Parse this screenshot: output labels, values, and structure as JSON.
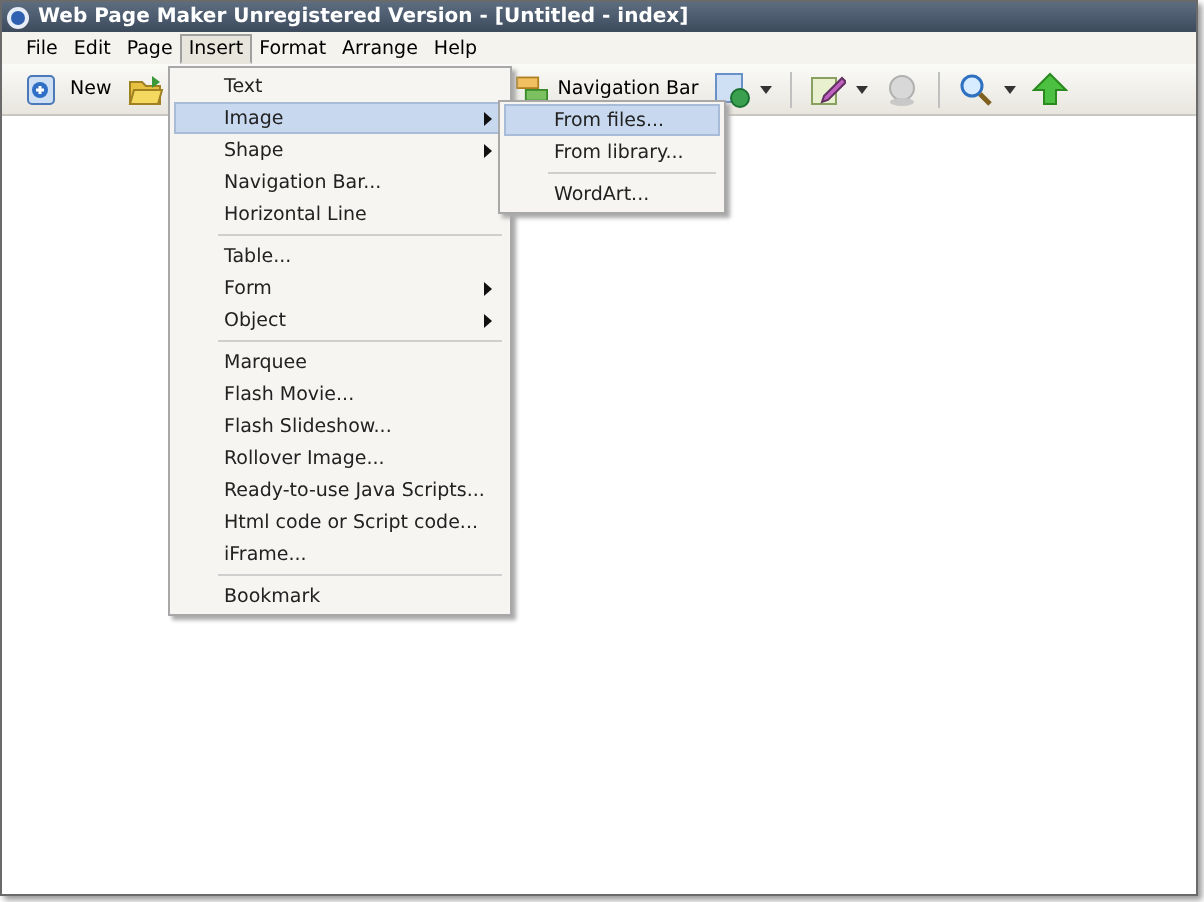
{
  "window": {
    "title": "Web Page Maker Unregistered Version - [Untitled - index]"
  },
  "menubar": [
    {
      "label": "File",
      "selected": false
    },
    {
      "label": "Edit",
      "selected": false
    },
    {
      "label": "Page",
      "selected": false
    },
    {
      "label": "Insert",
      "selected": true
    },
    {
      "label": "Format",
      "selected": false
    },
    {
      "label": "Arrange",
      "selected": false
    },
    {
      "label": "Help",
      "selected": false
    }
  ],
  "toolbar": [
    {
      "kind": "button",
      "label": "New"
    },
    {
      "kind": "button"
    },
    {
      "kind": "button",
      "label": "Navigation Bar"
    },
    {
      "kind": "dropdown"
    },
    {
      "kind": "separator"
    },
    {
      "kind": "dropdown"
    },
    {
      "kind": "button"
    },
    {
      "kind": "separator"
    },
    {
      "kind": "dropdown"
    },
    {
      "kind": "button"
    }
  ],
  "insert_menu": [
    {
      "kind": "item",
      "label": "Text",
      "selected": false
    },
    {
      "kind": "submenu",
      "label": "Image",
      "selected": true
    },
    {
      "kind": "submenu",
      "label": "Shape",
      "selected": false
    },
    {
      "kind": "item",
      "label": "Navigation Bar...",
      "selected": false
    },
    {
      "kind": "item",
      "label": "Horizontal Line",
      "selected": false
    },
    {
      "kind": "separator"
    },
    {
      "kind": "item",
      "label": "Table...",
      "selected": false
    },
    {
      "kind": "submenu",
      "label": "Form",
      "selected": false
    },
    {
      "kind": "submenu",
      "label": "Object",
      "selected": false
    },
    {
      "kind": "separator"
    },
    {
      "kind": "item",
      "label": "Marquee",
      "selected": false
    },
    {
      "kind": "item",
      "label": "Flash Movie...",
      "selected": false
    },
    {
      "kind": "item",
      "label": "Flash Slideshow...",
      "selected": false
    },
    {
      "kind": "item",
      "label": "Rollover Image...",
      "selected": false
    },
    {
      "kind": "item",
      "label": "Ready-to-use Java Scripts...",
      "selected": false
    },
    {
      "kind": "item",
      "label": "Html code or Script code...",
      "selected": false
    },
    {
      "kind": "item",
      "label": "iFrame...",
      "selected": false
    },
    {
      "kind": "separator"
    },
    {
      "kind": "item",
      "label": "Bookmark",
      "selected": false
    }
  ],
  "image_submenu": [
    {
      "kind": "item",
      "label": "From files...",
      "selected": true
    },
    {
      "kind": "item",
      "label": "From library...",
      "selected": false
    },
    {
      "kind": "separator"
    },
    {
      "kind": "item",
      "label": "WordArt...",
      "selected": false
    }
  ]
}
